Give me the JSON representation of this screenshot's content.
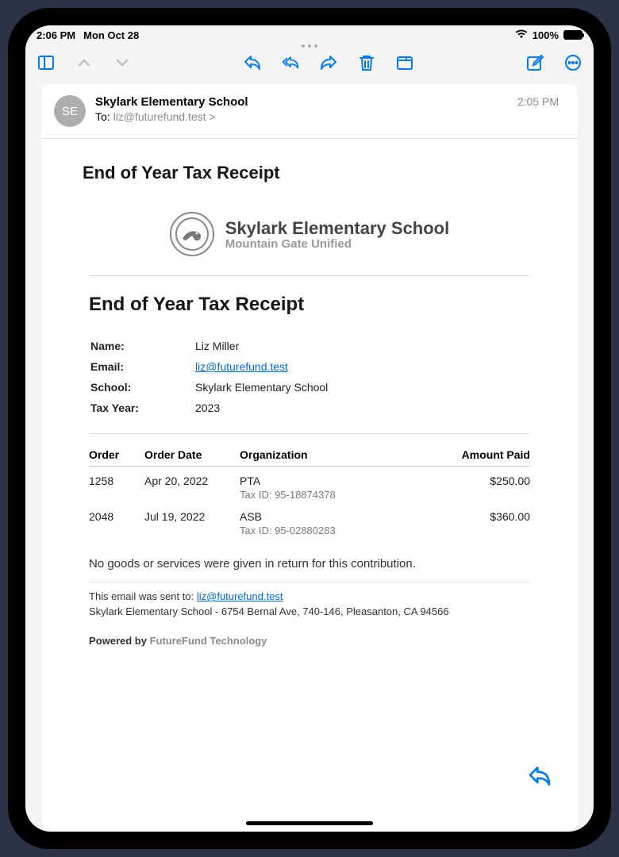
{
  "status": {
    "time": "2:06 PM",
    "date": "Mon Oct 28",
    "battery": "100%"
  },
  "message": {
    "avatar_initials": "SE",
    "sender": "Skylark Elementary School",
    "to_prefix": "To:",
    "to_address": "liz@futurefund.test",
    "to_suffix": ">",
    "time": "2:05 PM",
    "subject": "End of Year Tax Receipt"
  },
  "org": {
    "name": "Skylark Elementary School",
    "district": "Mountain Gate Unified"
  },
  "doc_title": "End of Year Tax Receipt",
  "details": {
    "name_label": "Name:",
    "name_value": "Liz Miller",
    "email_label": "Email:",
    "email_value": "liz@futurefund.test",
    "school_label": "School:",
    "school_value": "Skylark Elementary School",
    "year_label": "Tax Year:",
    "year_value": "2023"
  },
  "orders": {
    "headers": {
      "order": "Order",
      "date": "Order Date",
      "org": "Organization",
      "amount": "Amount Paid"
    },
    "rows": [
      {
        "order": "1258",
        "date": "Apr 20, 2022",
        "org": "PTA",
        "tax_id": "Tax ID: 95-18874378",
        "amount": "$250.00"
      },
      {
        "order": "2048",
        "date": "Jul 19, 2022",
        "org": "ASB",
        "tax_id": "Tax ID: 95-02880283",
        "amount": "$360.00"
      }
    ]
  },
  "disclaimer": "No goods or services were given in return for this contribution.",
  "footer": {
    "sent_to_prefix": "This email was sent to:",
    "sent_to_email": "liz@futurefund.test",
    "address": "Skylark Elementary School - 6754 Bernal Ave, 740-146, Pleasanton, CA 94566",
    "powered_by": "Powered by",
    "brand": "FutureFund Technology"
  }
}
